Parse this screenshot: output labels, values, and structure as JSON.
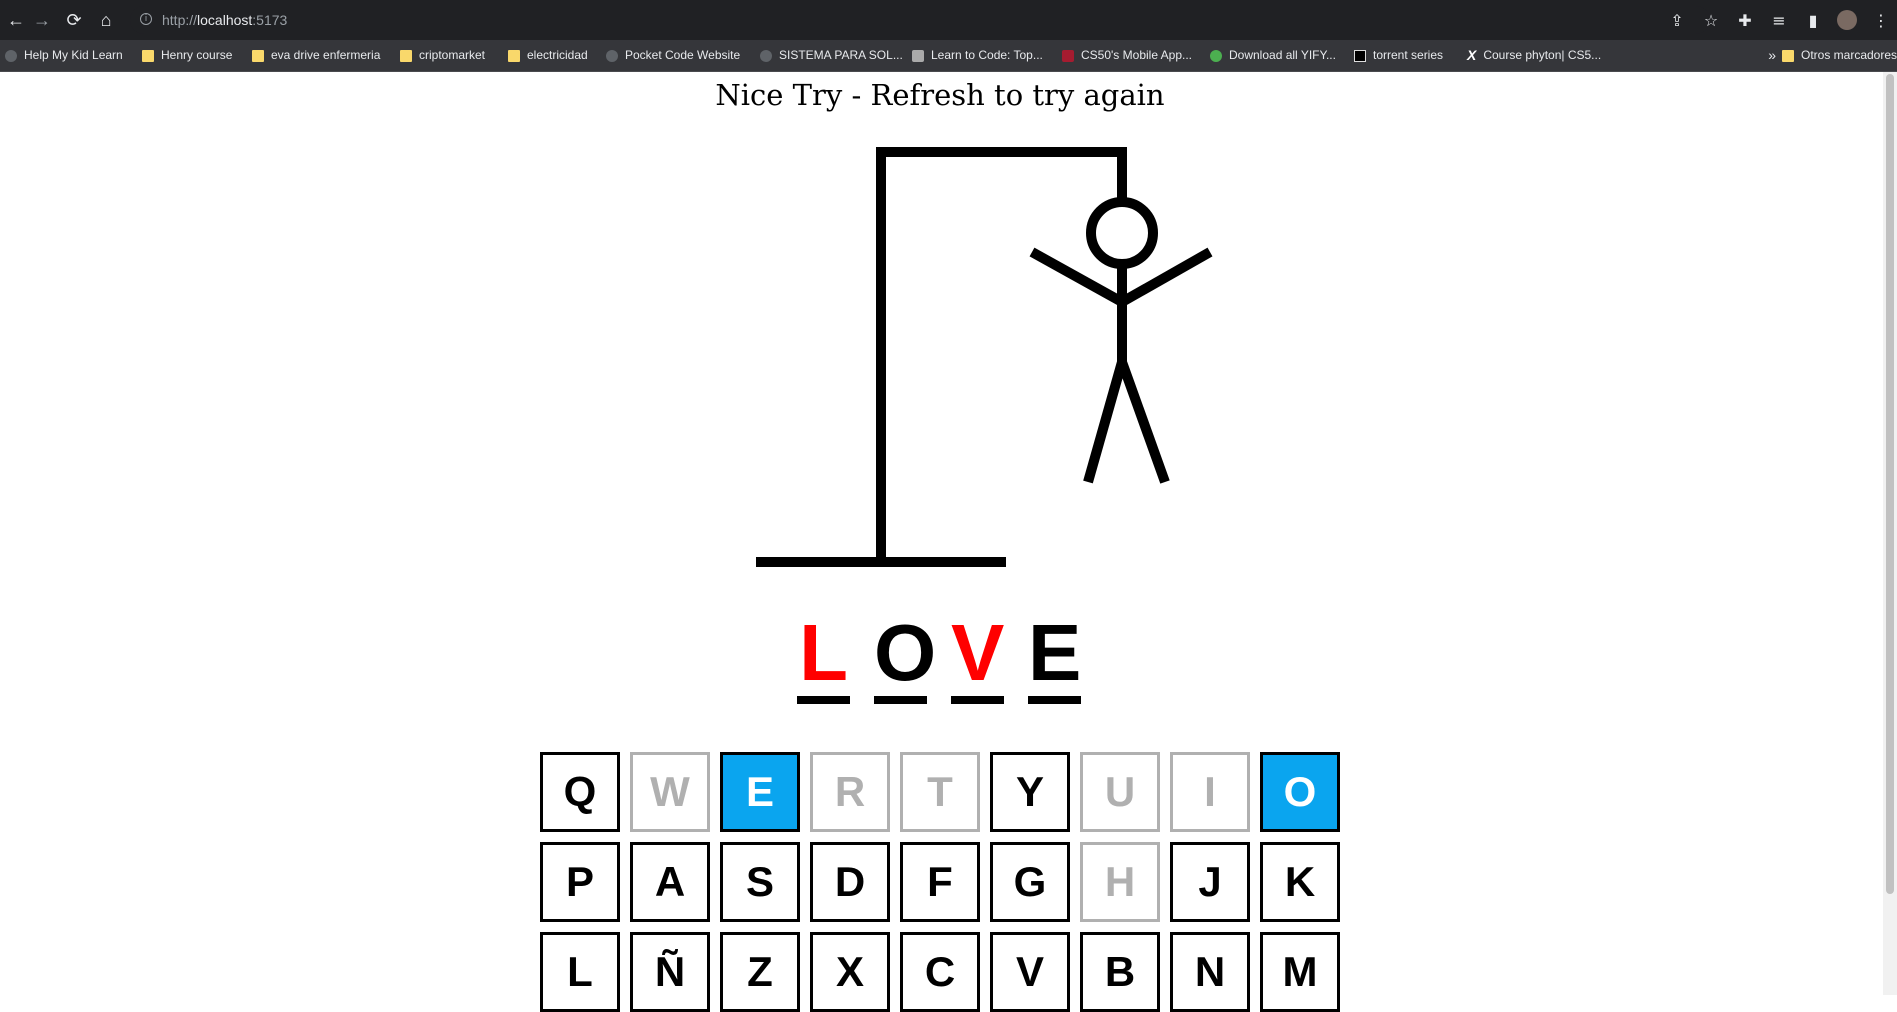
{
  "browser": {
    "url_scheme": "http://",
    "url_host": "localhost",
    "url_port": ":5173",
    "bookmarks": [
      {
        "label": "Help My Kid Learn",
        "icon": "globe-icon"
      },
      {
        "label": "Henry course",
        "icon": "folder-icon"
      },
      {
        "label": "eva drive enfermeria",
        "icon": "folder-icon"
      },
      {
        "label": "criptomarket",
        "icon": "folder-icon"
      },
      {
        "label": "electricidad",
        "icon": "folder-icon"
      },
      {
        "label": "Pocket Code Website",
        "icon": "pocket-code-icon"
      },
      {
        "label": "SISTEMA PARA SOL...",
        "icon": "globe-icon"
      },
      {
        "label": "Learn to Code: Top...",
        "icon": "shield-icon"
      },
      {
        "label": "CS50's Mobile App...",
        "icon": "harvard-icon"
      },
      {
        "label": "Download all YIFY...",
        "icon": "yify-icon"
      },
      {
        "label": "torrent series",
        "icon": "tv-icon"
      },
      {
        "label": "Course phyton| CS5...",
        "icon": "x-icon"
      }
    ],
    "more_bookmarks": "»",
    "other_bookmarks": "Otros marcadores"
  },
  "game": {
    "status_title": "Nice Try - Refresh to try again",
    "word": [
      {
        "letter": "L",
        "missed": true
      },
      {
        "letter": "O",
        "missed": false
      },
      {
        "letter": "V",
        "missed": true
      },
      {
        "letter": "E",
        "missed": false
      }
    ],
    "keys": [
      {
        "letter": "Q",
        "state": "unused"
      },
      {
        "letter": "W",
        "state": "used"
      },
      {
        "letter": "E",
        "state": "hit"
      },
      {
        "letter": "R",
        "state": "used"
      },
      {
        "letter": "T",
        "state": "used"
      },
      {
        "letter": "Y",
        "state": "unused"
      },
      {
        "letter": "U",
        "state": "used"
      },
      {
        "letter": "I",
        "state": "used"
      },
      {
        "letter": "O",
        "state": "hit"
      },
      {
        "letter": "P",
        "state": "unused"
      },
      {
        "letter": "A",
        "state": "unused"
      },
      {
        "letter": "S",
        "state": "unused"
      },
      {
        "letter": "D",
        "state": "unused"
      },
      {
        "letter": "F",
        "state": "unused"
      },
      {
        "letter": "G",
        "state": "unused"
      },
      {
        "letter": "H",
        "state": "used"
      },
      {
        "letter": "J",
        "state": "unused"
      },
      {
        "letter": "K",
        "state": "unused"
      },
      {
        "letter": "L",
        "state": "unused"
      },
      {
        "letter": "Ñ",
        "state": "unused"
      },
      {
        "letter": "Z",
        "state": "unused"
      },
      {
        "letter": "X",
        "state": "unused"
      },
      {
        "letter": "C",
        "state": "unused"
      },
      {
        "letter": "V",
        "state": "unused"
      },
      {
        "letter": "B",
        "state": "unused"
      },
      {
        "letter": "N",
        "state": "unused"
      },
      {
        "letter": "M",
        "state": "unused"
      }
    ],
    "colors": {
      "missed_letter": "#ff0000",
      "hit_key": "#0aa5ef",
      "used_key": "#b0b0b0"
    }
  }
}
